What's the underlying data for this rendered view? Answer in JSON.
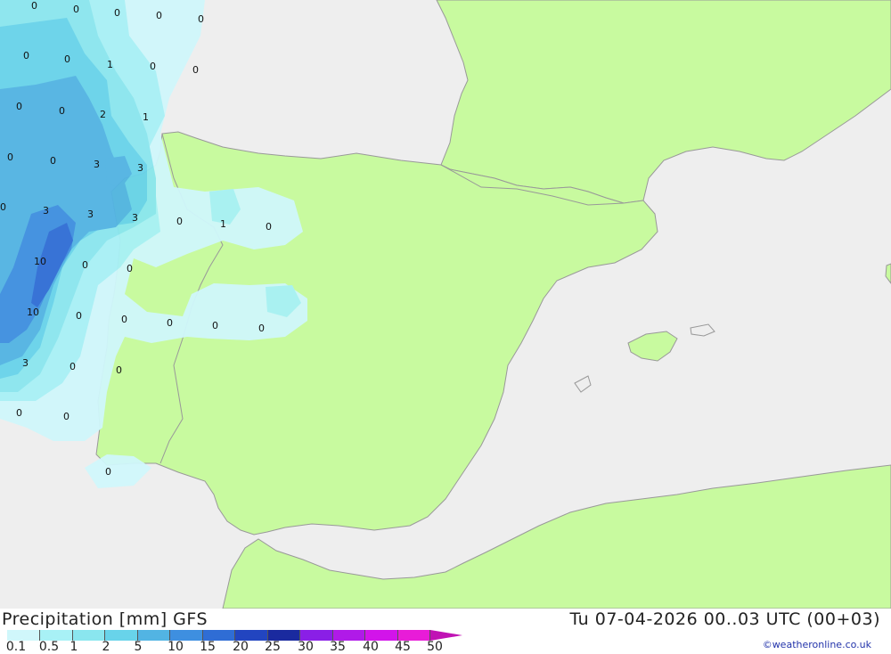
{
  "map": {
    "precip_labels": [
      "0",
      "0",
      "0",
      "0",
      "0",
      "0",
      "0",
      "1",
      "0",
      "0",
      "0",
      "0",
      "2",
      "1",
      "0",
      "0",
      "3",
      "3",
      "0",
      "3",
      "3",
      "3",
      "0",
      "1",
      "0",
      "10",
      "0",
      "0",
      "10",
      "0",
      "0",
      "0",
      "0",
      "0",
      "3",
      "0",
      "0",
      "0",
      "0",
      "0"
    ]
  },
  "footer": {
    "title": "Precipitation [mm]  GFS",
    "datetime": "Tu 07-04-2026 00..03 UTC (00+03)",
    "credit": "©weatheronline.co.uk"
  },
  "legend": {
    "ticks": [
      "0.1",
      "0.5",
      "1",
      "2",
      "5",
      "10",
      "15",
      "20",
      "25",
      "30",
      "35",
      "40",
      "45",
      "50"
    ],
    "colors": [
      "#d0f7fb",
      "#a8f1f6",
      "#8ae6ef",
      "#68d3ea",
      "#52b4e3",
      "#3e8fe0",
      "#2f6dd5",
      "#2245c0",
      "#1a2a9f",
      "#8a1fe6",
      "#b01ae8",
      "#d214ea",
      "#e81cd8",
      "#c013b4"
    ],
    "sea_color": "#eeeeee",
    "land_color": "#c8fa9f",
    "border_color": "#999999"
  }
}
